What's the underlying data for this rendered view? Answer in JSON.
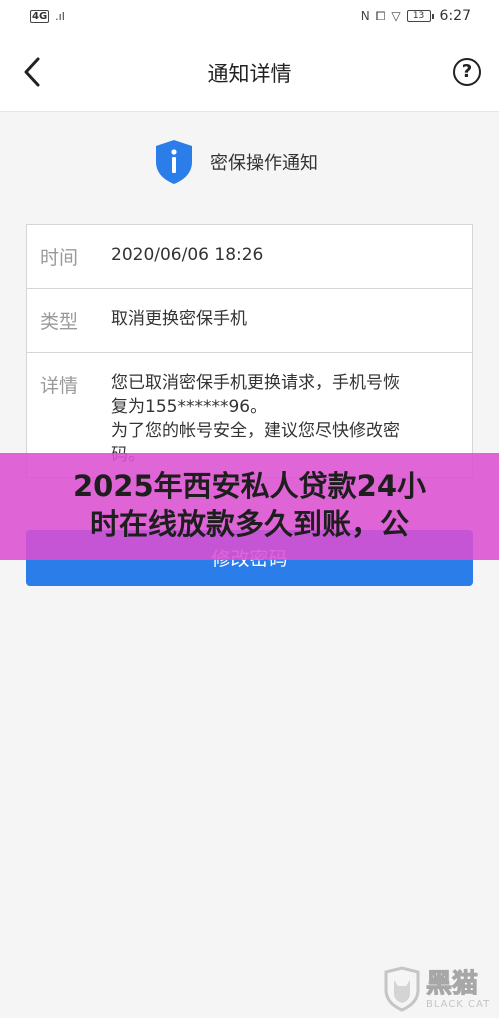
{
  "status_bar": {
    "network": "4G",
    "signal": ".ıl",
    "nfc_icon": "N",
    "vibrate_icon": "⧠",
    "wifi_icon": "▽",
    "battery": "13",
    "time": "6:27"
  },
  "header": {
    "title": "通知详情",
    "help": "?"
  },
  "notice": {
    "title": "密保操作通知"
  },
  "details": {
    "time_label": "时间",
    "time_value": "2020/06/06 18:26",
    "type_label": "类型",
    "type_value": "取消更换密保手机",
    "detail_label": "详情",
    "detail_lines": [
      "您已取消密保手机更换请求，手机号恢",
      "复为155******96。",
      "为了您的帐号安全，建议您尽快修改密",
      "码。"
    ]
  },
  "action": {
    "button": "修改密码"
  },
  "overlay": {
    "line1": "2025年西安私人贷款24小",
    "line2": "时在线放款多久到账，公"
  },
  "watermark": {
    "cn": "黑猫",
    "en": "BLACK CAT"
  },
  "colors": {
    "accent": "#2b7de9",
    "overlay": "#dc50d2"
  }
}
